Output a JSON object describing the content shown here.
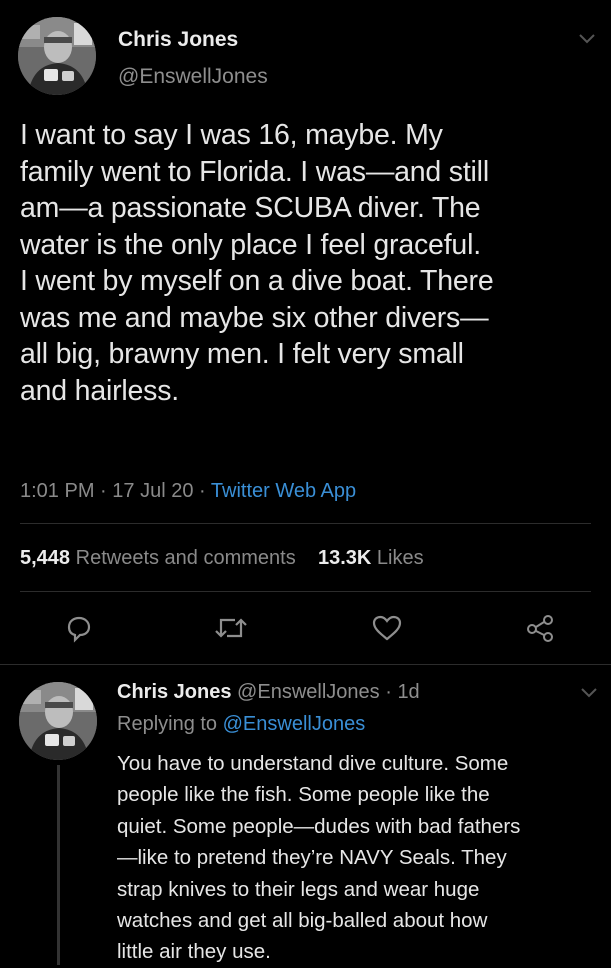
{
  "main_tweet": {
    "author_name": "Chris Jones",
    "author_handle": "@EnswellJones",
    "text_lines": [
      "I want to say I was 16, maybe. My",
      "family went to Florida. I was—and still",
      "am—a passionate SCUBA diver. The",
      "water is the only place I feel graceful.",
      "I went by myself on a dive boat. There",
      "was me and maybe six other divers—",
      "all big, brawny men. I felt very small",
      "and hairless."
    ],
    "time": "1:01 PM",
    "date": "17 Jul 20",
    "source": "Twitter Web App",
    "separator": "·",
    "retweets_count": "5,448",
    "retweets_label": "Retweets and comments",
    "likes_count": "13.3K",
    "likes_label": "Likes",
    "actions": [
      "reply-icon",
      "retweet-icon",
      "like-icon",
      "share-icon"
    ]
  },
  "reply_tweet": {
    "author_name": "Chris Jones",
    "author_handle": "@EnswellJones",
    "age": "1d",
    "separator": "·",
    "replying_label": "Replying to",
    "replying_handle": "@EnswellJones",
    "text_lines": [
      "You have to understand dive culture. Some",
      "people like the fish. Some people like the",
      "quiet. Some people—dudes with bad fathers",
      "—like to pretend they’re NAVY Seals. They",
      "strap knives to their legs and wear huge",
      "watches and get all big-balled about how",
      "little air they use."
    ]
  },
  "colors": {
    "background": "#000000",
    "link": "#3a8fd6",
    "muted": "#8a8a8a",
    "text": "#e6e6e6"
  }
}
